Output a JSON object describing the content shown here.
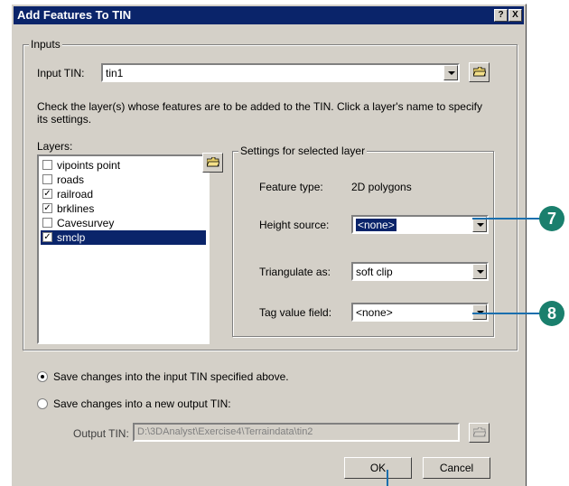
{
  "title": "Add Features To TIN",
  "titlebar_buttons": {
    "help": "?",
    "close": "X"
  },
  "inputs_group": "Inputs",
  "input_tin_label": "Input TIN:",
  "input_tin_value": "tin1",
  "instruction": "Check the layer(s) whose features are to be added to the TIN. Click a layer's name to specify its settings.",
  "layers_label": "Layers:",
  "layers": [
    {
      "name": "vipoints point",
      "checked": false
    },
    {
      "name": "roads",
      "checked": false
    },
    {
      "name": "railroad",
      "checked": true
    },
    {
      "name": "brklines",
      "checked": true
    },
    {
      "name": "Cavesurvey",
      "checked": false
    },
    {
      "name": "smclp",
      "checked": true,
      "selected": true
    }
  ],
  "settings_group": "Settings for selected layer",
  "feature_type_label": "Feature type:",
  "feature_type_value": "2D polygons",
  "height_source_label": "Height source:",
  "height_source_value": "<none>",
  "triangulate_label": "Triangulate as:",
  "triangulate_value": "soft clip",
  "tag_value_label": "Tag value field:",
  "tag_value_value": "<none>",
  "save_option_1": "Save changes into the input TIN specified above.",
  "save_option_2": "Save changes into a new output TIN:",
  "output_tin_label": "Output TIN:",
  "output_tin_value": "D:\\3DAnalyst\\Exercise4\\Terraindata\\tin2",
  "ok_label": "OK",
  "cancel_label": "Cancel",
  "callouts": [
    "7",
    "8"
  ],
  "colors": {
    "titlebar": "#0a246a",
    "callout": "#1a7f6d",
    "leader": "#1a6fae"
  }
}
